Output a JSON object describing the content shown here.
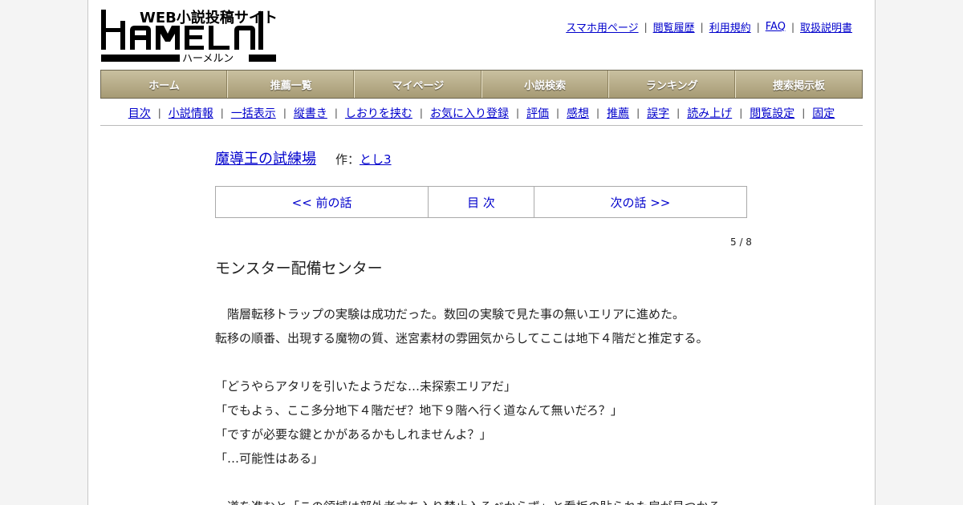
{
  "logo": {
    "tagline": "WEB小説投稿サイト",
    "wordmark": "HAMELN",
    "kana": "ハーメルン"
  },
  "header_links": [
    "スマホ用ページ",
    "閲覧履歴",
    "利用規約",
    "FAQ",
    "取扱説明書"
  ],
  "nav": [
    "ホーム",
    "推薦一覧",
    "マイページ",
    "小説検索",
    "ランキング",
    "捜索掲示板"
  ],
  "subnav": [
    "目次",
    "小説情報",
    "一括表示",
    "縦書き",
    "しおりを挟む",
    "お気に入り登録",
    "評価",
    "感想",
    "推薦",
    "誤字",
    "読み上げ",
    "閲覧設定",
    "固定"
  ],
  "novel": {
    "title": "魔導王の試練場",
    "author_prefix": "作：",
    "author": "とし3"
  },
  "chapter_nav": {
    "prev": "<< 前の話",
    "toc": "目 次",
    "next": "次の話 >>"
  },
  "page_count": "5 / 8",
  "chapter_title": "モンスター配備センター",
  "body": [
    "　階層転移トラップの実験は成功だった。数回の実験で見た事の無いエリアに進めた。",
    "転移の順番、出現する魔物の質、迷宮素材の雰囲気からしてここは地下４階だと推定する。",
    "",
    "「どうやらアタリを引いたようだな…未探索エリアだ」",
    "「でもよぅ、ここ多分地下４階だぜ？地下９階へ行く道なんて無いだろ？」",
    "「ですが必要な鍵とかがあるかもしれませんよ？」",
    "「…可能性はある」",
    "",
    "　道を進むと「この領域は部外者立ち入り禁止入るべからず」と看板の貼られた扉が見つかる。"
  ]
}
